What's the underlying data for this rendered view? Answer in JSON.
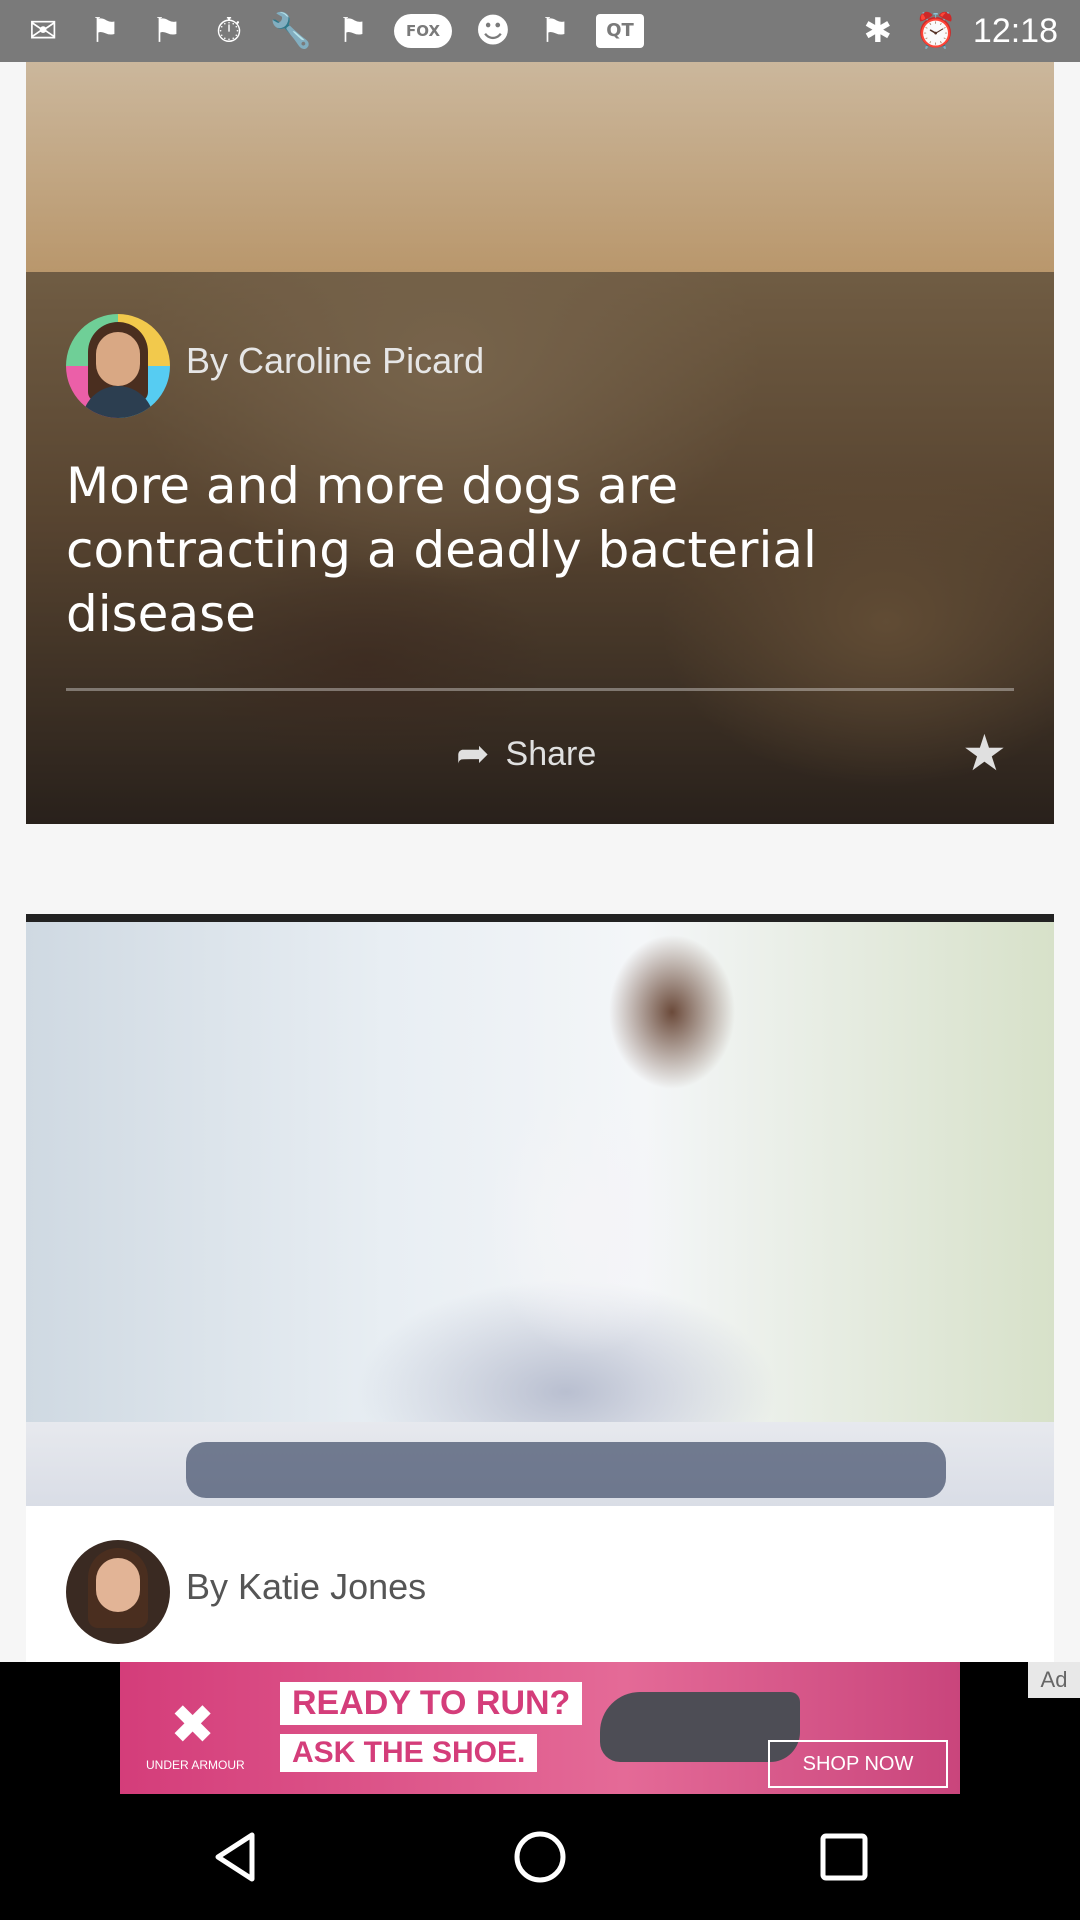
{
  "status_bar": {
    "time": "12:18",
    "left_icons": [
      "chat-icon",
      "flipboard-icon",
      "flipboard-icon",
      "stopwatch-icon",
      "wrench-icon",
      "flipboard-icon",
      "fox-sports-icon",
      "smiley-icon",
      "flipboard-icon",
      "qt-icon"
    ],
    "fox_label": "FOX",
    "qt_label": "QT",
    "right_icons": [
      "bluetooth-icon",
      "alarm-icon"
    ]
  },
  "article1": {
    "author": "By Caroline Picard",
    "headline": "More and more dogs are contracting a deadly bacterial disease",
    "share_label": "Share"
  },
  "article2": {
    "author": "By Katie Jones"
  },
  "ad": {
    "line1": "READY TO RUN?",
    "line2": "ASK THE SHOE.",
    "brand": "UNDER ARMOUR",
    "shop_now": "SHOP NOW",
    "ad_label": "Ad"
  },
  "colors": {
    "status_bar": "#7a7a7a",
    "page_bg": "#f6f6f6",
    "ad_pink": "#d43d7a",
    "nav_bar": "#000000"
  }
}
